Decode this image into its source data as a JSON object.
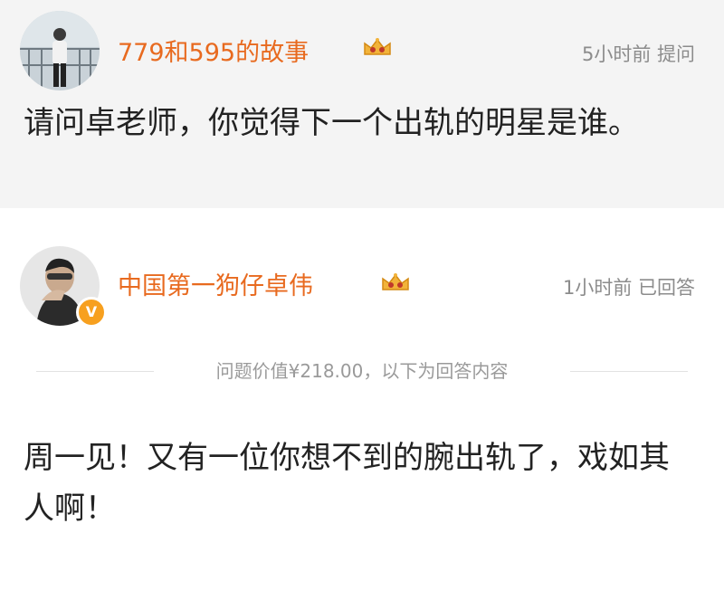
{
  "question": {
    "username": "779和595的故事",
    "meta": "5小时前 提问",
    "text": "请问卓老师，你觉得下一个出轨的明星是谁。"
  },
  "answer": {
    "username": "中国第一狗仔卓伟",
    "meta": "1小时前 已回答",
    "verified_badge": "V",
    "divider_text": "问题价值¥218.00，以下为回答内容",
    "text": "周一见！又有一位你想不到的腕出轨了，戏如其人啊！"
  },
  "icons": {
    "crown": "crown-vip-icon",
    "verified": "verified-v-icon"
  },
  "colors": {
    "username": "#e86a1f",
    "meta": "#8c8c8c",
    "question_bg": "#f4f4f4",
    "badge": "#f7a01f"
  }
}
